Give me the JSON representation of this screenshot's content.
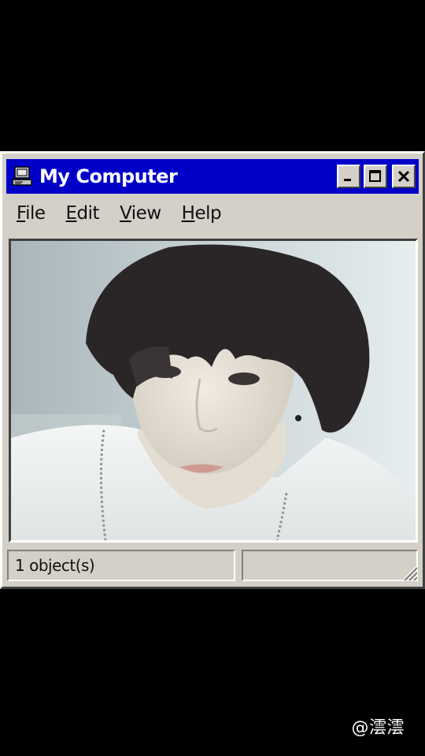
{
  "window": {
    "title": "My Computer",
    "title_icon": "computer-icon",
    "titlebar_color": "#0000c8",
    "buttons": [
      {
        "name": "minimize-button",
        "icon": "minimize-icon"
      },
      {
        "name": "maximize-button",
        "icon": "maximize-icon"
      },
      {
        "name": "close-button",
        "icon": "close-icon"
      }
    ]
  },
  "menu": {
    "items": [
      {
        "accel": "F",
        "rest": "ile"
      },
      {
        "accel": "E",
        "rest": "dit"
      },
      {
        "accel": "V",
        "rest": "iew"
      },
      {
        "accel": "H",
        "rest": "elp"
      }
    ]
  },
  "status": {
    "left_text": "1 object(s)",
    "right_text": ""
  },
  "watermark": "@澐澐",
  "colors": {
    "background": "#000000",
    "chrome": "#d4d0c8",
    "highlight": "#ffffff",
    "shadow": "#404040"
  }
}
